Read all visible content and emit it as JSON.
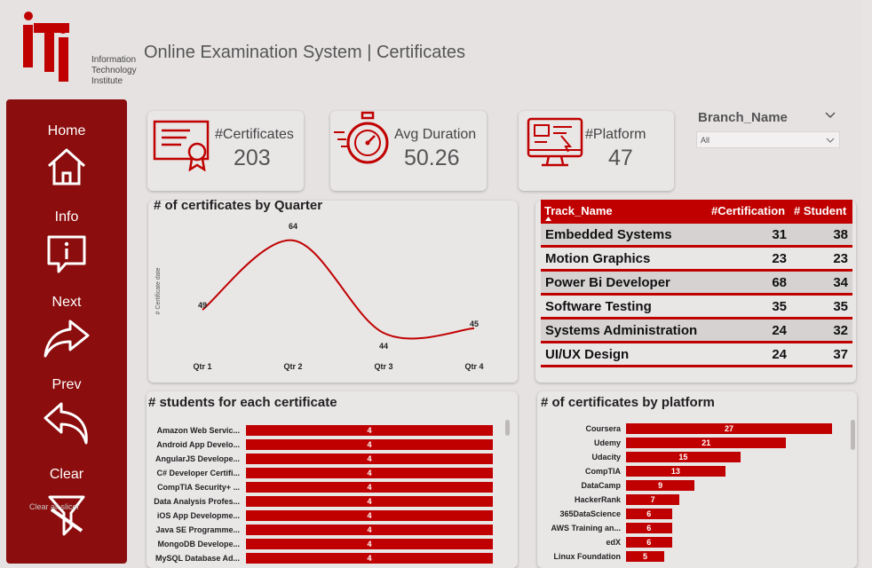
{
  "header": {
    "logo_lines": [
      "Information",
      "Technology",
      "Institute"
    ],
    "title": "Online Examination System | Certificates"
  },
  "nav": [
    {
      "label": "Home",
      "icon": "home-icon"
    },
    {
      "label": "Info",
      "icon": "info-icon"
    },
    {
      "label": "Next",
      "icon": "share-forward-icon"
    },
    {
      "label": "Prev",
      "icon": "reply-back-icon"
    },
    {
      "label": "Clear",
      "icon": "filter-clear-icon",
      "tooltip": "Clear all slicer"
    }
  ],
  "kpis": [
    {
      "label": "#Certificates",
      "value": "203",
      "icon": "certificate-icon"
    },
    {
      "label": "Avg Duration",
      "value": "50.26",
      "icon": "stopwatch-icon"
    },
    {
      "label": "#Platform",
      "value": "47",
      "icon": "monitor-platform-icon"
    }
  ],
  "slicer": {
    "label": "Branch_Name",
    "value": "All"
  },
  "colors": {
    "accent": "#c00000",
    "sidebar": "#8b0d0d"
  },
  "table": {
    "headers": [
      "Track_Name",
      "#Certification",
      "# Student"
    ],
    "rows": [
      [
        "Embedded Systems",
        "31",
        "38"
      ],
      [
        "Motion Graphics",
        "23",
        "23"
      ],
      [
        "Power Bi Developer",
        "68",
        "34"
      ],
      [
        "Software Testing",
        "35",
        "35"
      ],
      [
        "Systems Administration",
        "24",
        "32"
      ],
      [
        "UI/UX Design",
        "24",
        "37"
      ]
    ]
  },
  "chart_data": [
    {
      "type": "line",
      "title": "# of certificates by Quarter",
      "ylabel": "# Certificate date",
      "xlabel": "",
      "categories": [
        "Qtr 1",
        "Qtr 2",
        "Qtr 3",
        "Qtr 4"
      ],
      "values": [
        49,
        64,
        44,
        45
      ],
      "color": "#c00000"
    },
    {
      "type": "bar",
      "title": "# students for each certificate",
      "categories": [
        "Amazon Web Servic...",
        "Android App Develo...",
        "AngularJS Develope...",
        "C# Developer Certifi...",
        "CompTIA Security+ ...",
        "Data Analysis Profes...",
        "iOS App Developme...",
        "Java SE Programme...",
        "MongoDB Develope...",
        "MySQL Database Ad..."
      ],
      "values": [
        4,
        4,
        4,
        4,
        4,
        4,
        4,
        4,
        4,
        4
      ],
      "xlim": [
        0,
        4
      ]
    },
    {
      "type": "bar",
      "title": "# of certificates by platform",
      "categories": [
        "Coursera",
        "Udemy",
        "Udacity",
        "CompTIA",
        "DataCamp",
        "HackerRank",
        "365DataScience",
        "AWS Training an...",
        "edX",
        "Linux Foundation"
      ],
      "values": [
        27,
        21,
        15,
        13,
        9,
        7,
        6,
        6,
        6,
        5
      ],
      "xlim": [
        0,
        27
      ]
    }
  ]
}
